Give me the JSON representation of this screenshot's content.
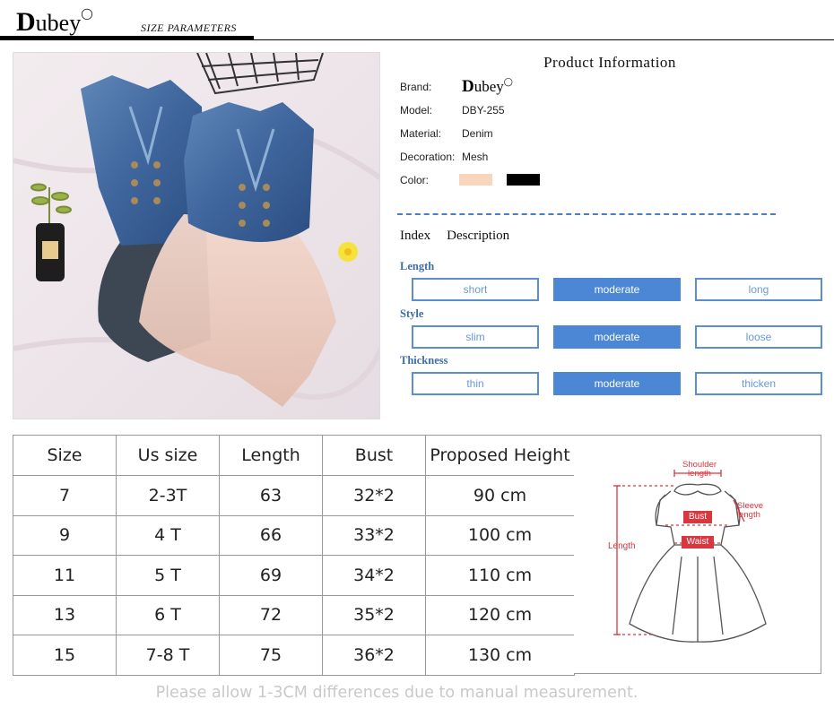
{
  "header": {
    "logo_text": "Dubey",
    "section_title": "SIZE  PARAMETERS"
  },
  "product_info": {
    "title": "Product  Information",
    "brand_label": "Brand:",
    "brand_value": "Dubey",
    "model_label": "Model:",
    "model_value": "DBY-255",
    "material_label": "Material:",
    "material_value": "Denim",
    "decoration_label": "Decoration:",
    "decoration_value": "Mesh",
    "color_label": "Color:",
    "colors": [
      "#f8d6be",
      "#000000"
    ]
  },
  "index": {
    "index_label": "Index",
    "description_label": "Description",
    "accent_color": "#4c87d6",
    "groups": [
      {
        "name": "Length",
        "options": [
          "short",
          "moderate",
          "long"
        ],
        "selected": "moderate"
      },
      {
        "name": "Style",
        "options": [
          "slim",
          "moderate",
          "loose"
        ],
        "selected": "moderate"
      },
      {
        "name": "Thickness",
        "options": [
          "thin",
          "moderate",
          "thicken"
        ],
        "selected": "moderate"
      }
    ]
  },
  "size_table": {
    "headers": [
      "Size",
      "Us size",
      "Length",
      "Bust",
      "Proposed Height"
    ],
    "rows": [
      [
        "7",
        "2-3T",
        "63",
        "32*2",
        "90 cm"
      ],
      [
        "9",
        "4 T",
        "66",
        "33*2",
        "100 cm"
      ],
      [
        "11",
        "5 T",
        "69",
        "34*2",
        "110 cm"
      ],
      [
        "13",
        "6 T",
        "72",
        "35*2",
        "120 cm"
      ],
      [
        "15",
        "7-8 T",
        "75",
        "36*2",
        "130 cm"
      ]
    ]
  },
  "diagram": {
    "shoulder_label": "Shoulder length",
    "sleeve_label": "Sleeve length",
    "bust_label": "Bust",
    "waist_label": "Waist",
    "length_label": "Length",
    "accent_color": "#d9363e"
  },
  "footer": {
    "note": "Please allow 1-3CM differences due to manual measurement."
  }
}
